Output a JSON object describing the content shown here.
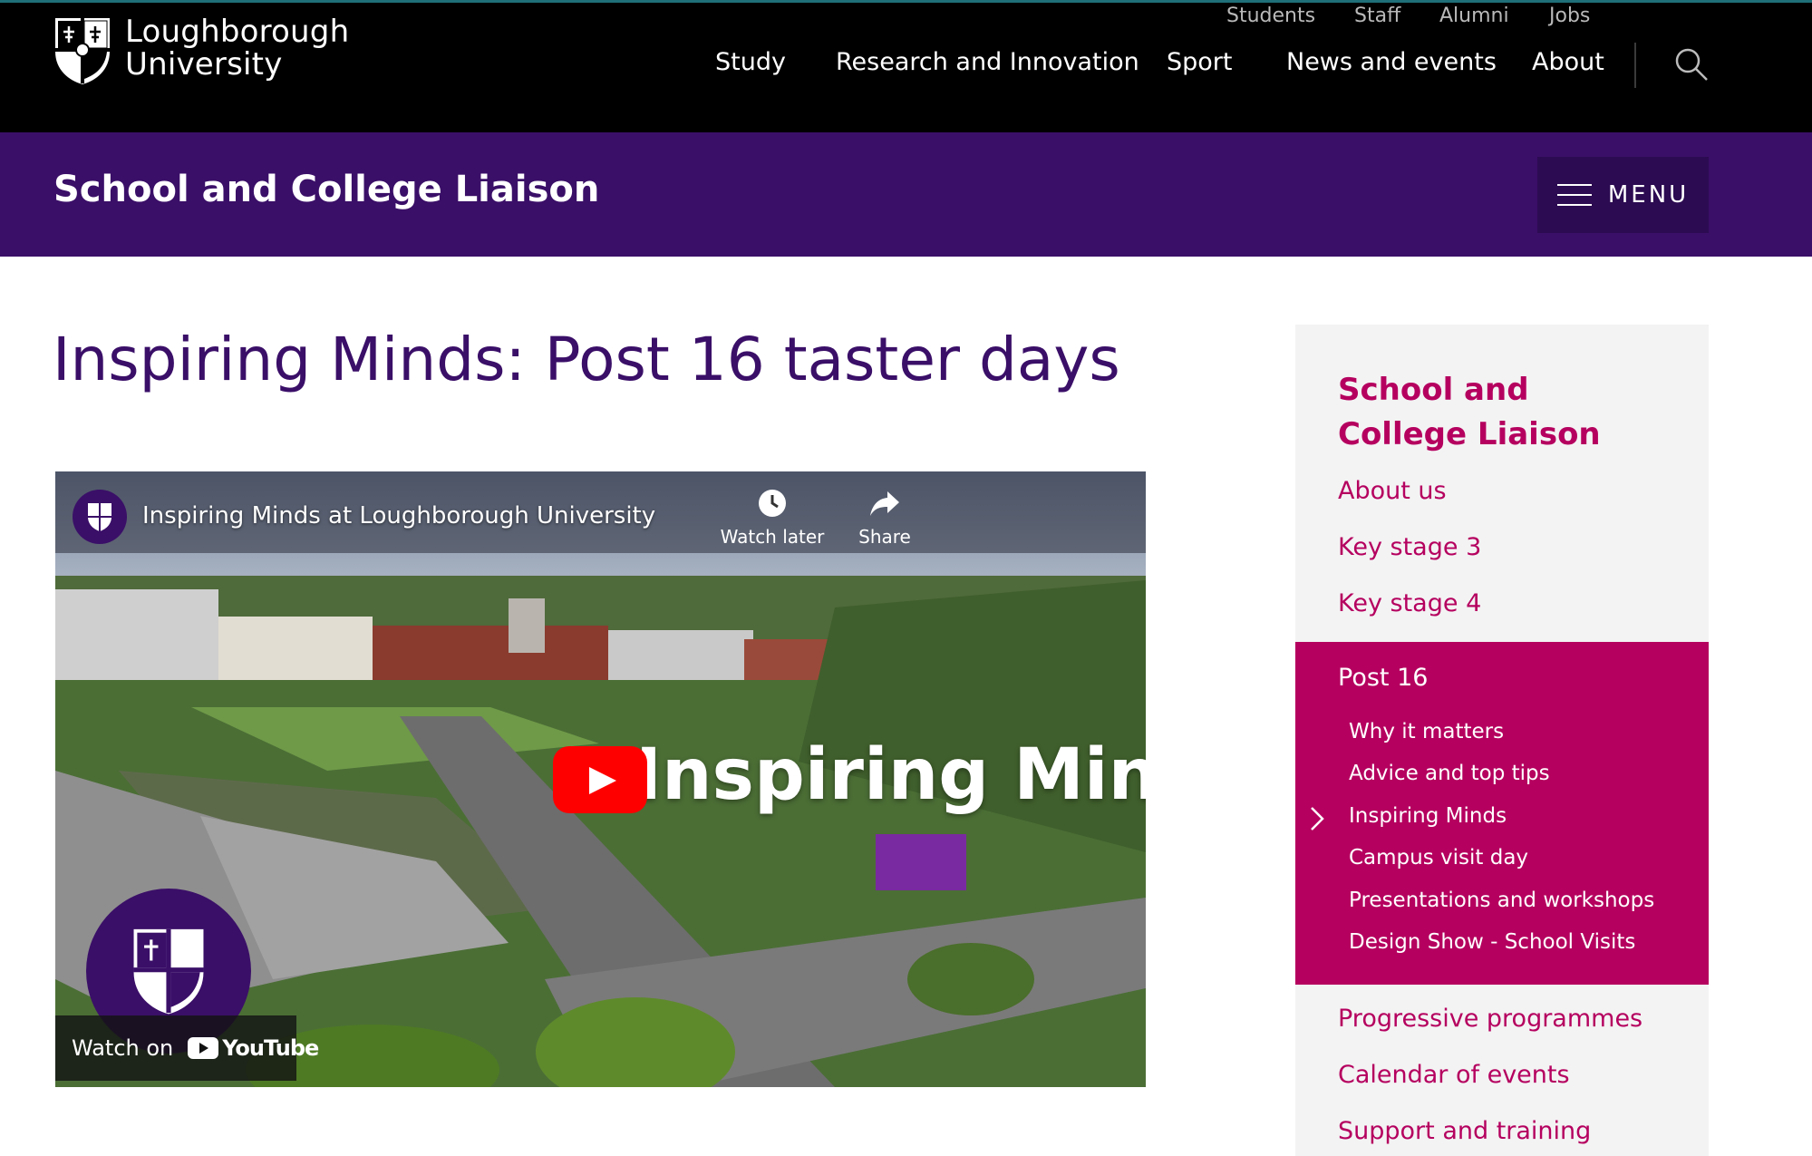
{
  "header": {
    "logo_line1": "Loughborough",
    "logo_line2": "University",
    "utility_links": [
      "Students",
      "Staff",
      "Alumni",
      "Jobs"
    ],
    "main_nav": [
      "Study",
      "Research and Innovation",
      "Sport",
      "News and events",
      "About"
    ],
    "search_icon": "search-icon"
  },
  "section_bar": {
    "title": "School and College Liaison",
    "menu_label": "MENU",
    "menu_icon": "hamburger-icon",
    "color": "#3a0f68"
  },
  "page": {
    "title": "Inspiring Minds: Post 16 taster days"
  },
  "video": {
    "title": "Inspiring Minds at Loughborough University",
    "watch_later": "Watch later",
    "share": "Share",
    "overlay_text": "Inspiring Minds",
    "watch_on": "Watch on",
    "youtube": "YouTube",
    "play_icon": "play-icon"
  },
  "sidebar": {
    "heading": "School and College Liaison",
    "links_top": [
      "About us",
      "Key stage 3",
      "Key stage 4"
    ],
    "active_section": "Post 16",
    "sub_links": [
      "Why it matters",
      "Advice and top tips",
      "Inspiring Minds",
      "Campus visit day",
      "Presentations and workshops",
      "Design Show - School Visits"
    ],
    "current_sub": "Inspiring Minds",
    "links_bottom": [
      "Progressive programmes",
      "Calendar of events",
      "Support and training"
    ],
    "accent_color": "#b5005f"
  }
}
